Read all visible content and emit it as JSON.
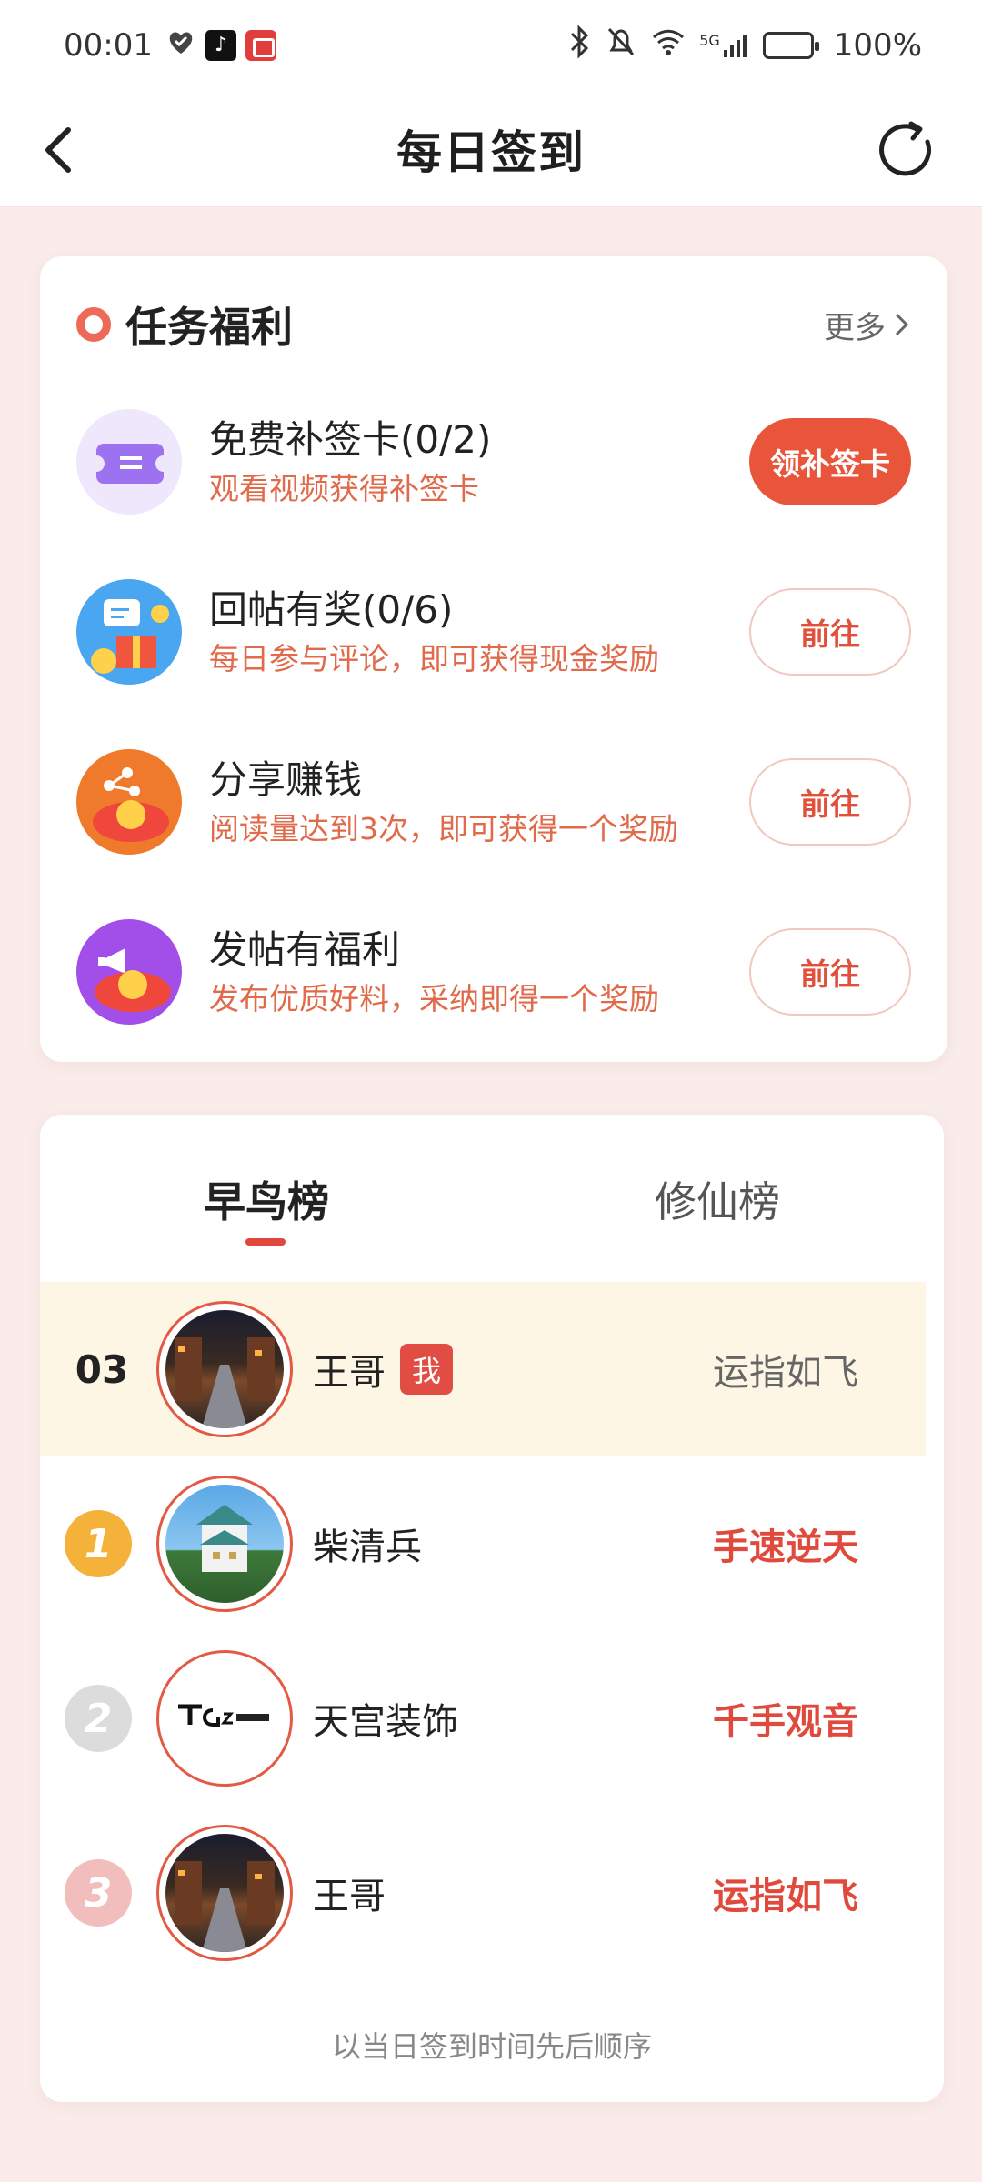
{
  "status_bar": {
    "time": "00:01",
    "battery": "100%",
    "signal": "5G",
    "tiktok_glyph": "♪"
  },
  "header": {
    "title": "每日签到"
  },
  "tasks": {
    "title": "任务福利",
    "more": "更多",
    "items": [
      {
        "name": "免费补签卡(0/2)",
        "desc": "观看视频获得补签卡",
        "button": "领补签卡"
      },
      {
        "name": "回帖有奖(0/6)",
        "desc": "每日参与评论，即可获得现金奖励",
        "button": "前往"
      },
      {
        "name": "分享赚钱",
        "desc": "阅读量达到3次，即可获得一个奖励",
        "button": "前往"
      },
      {
        "name": "发帖有福利",
        "desc": "发布优质好料，采纳即得一个奖励",
        "button": "前往"
      }
    ]
  },
  "ranking": {
    "tabs": [
      "早鸟榜",
      "修仙榜"
    ],
    "me": {
      "rank": "03",
      "name": "王哥",
      "badge": "我",
      "title": "运指如飞"
    },
    "rows": [
      {
        "medal": "1",
        "name": "柴清兵",
        "title": "手速逆天"
      },
      {
        "medal": "2",
        "name": "天宫装饰",
        "title": "千手观音"
      },
      {
        "medal": "3",
        "name": "王哥",
        "title": "运指如飞"
      }
    ],
    "footnote": "以当日签到时间先后顺序"
  },
  "colors": {
    "accent": "#e9553a",
    "background": "#f9ecea",
    "me_row": "#fdf6e4"
  }
}
